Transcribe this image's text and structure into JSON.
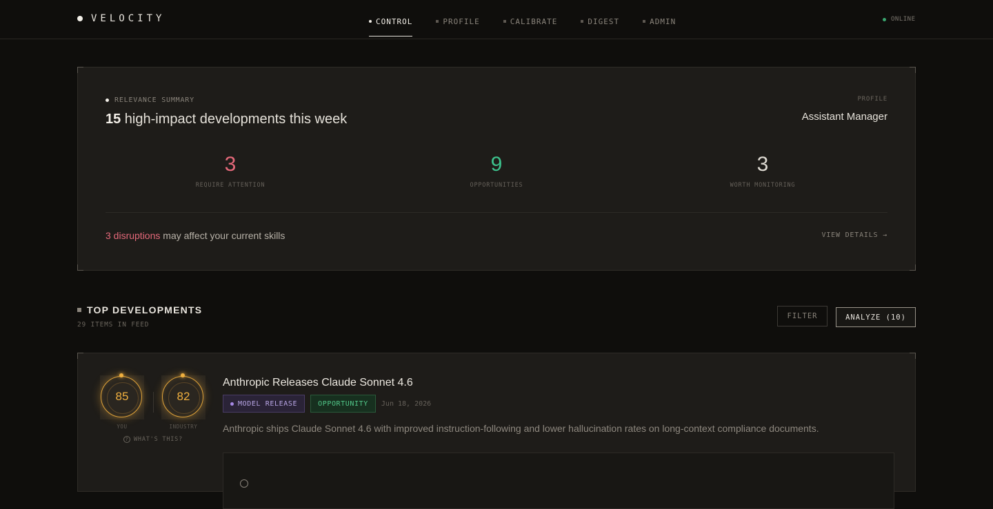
{
  "brand": {
    "name": "VELOCITY"
  },
  "nav": {
    "items": [
      {
        "label": "CONTROL",
        "active": true
      },
      {
        "label": "PROFILE",
        "active": false
      },
      {
        "label": "CALIBRATE",
        "active": false
      },
      {
        "label": "DIGEST",
        "active": false
      },
      {
        "label": "ADMIN",
        "active": false
      }
    ]
  },
  "status": {
    "label": "ONLINE",
    "color": "#3aa56f"
  },
  "summary": {
    "label": "RELEVANCE SUMMARY",
    "count": "15",
    "title_rest": " high-impact developments this week",
    "profile_label": "PROFILE",
    "profile_value": "Assistant Manager",
    "stats": [
      {
        "value": "3",
        "label": "REQUIRE ATTENTION",
        "color": "#e5697a"
      },
      {
        "value": "9",
        "label": "OPPORTUNITIES",
        "color": "#3dc28d"
      },
      {
        "value": "3",
        "label": "WORTH MONITORING",
        "color": "#dedad2"
      }
    ],
    "disruptions_highlight": "3 disruptions",
    "disruptions_rest": " may affect your current skills",
    "view_details": "VIEW DETAILS →"
  },
  "developments": {
    "title": "TOP DEVELOPMENTS",
    "subtitle": "29 ITEMS IN FEED",
    "filter_label": "FILTER",
    "analyze_label": "ANALYZE (10)",
    "items": [
      {
        "score_you": "85",
        "score_you_label": "YOU",
        "score_industry": "82",
        "score_industry_label": "INDUSTRY",
        "whats_this": "WHAT'S THIS?",
        "title": "Anthropic Releases Claude Sonnet 4.6",
        "tag_category": "MODEL RELEASE",
        "tag_type": "OPPORTUNITY",
        "date": "Jun 18, 2026",
        "description": "Anthropic ships Claude Sonnet 4.6 with improved instruction-following and lower hallucination rates on long-context compliance documents."
      }
    ]
  },
  "colors": {
    "accent_amber": "#f0b03f",
    "model_purple": "#b9a6e6",
    "opportunity_green": "#52c98a"
  }
}
